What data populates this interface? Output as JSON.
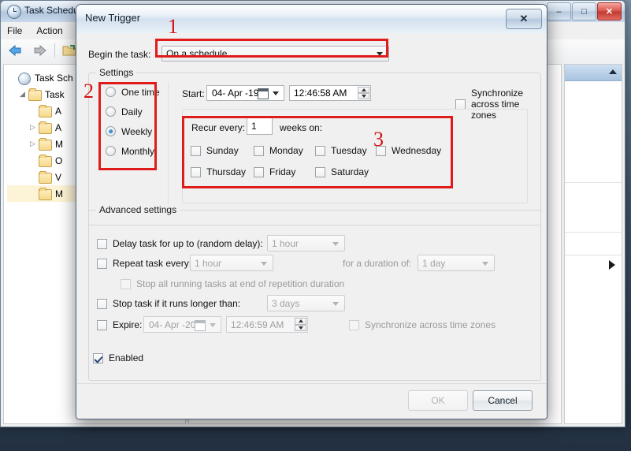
{
  "background_window": {
    "title": "Task Scheduler",
    "icon": "clock-icon",
    "menu": [
      "File",
      "Action"
    ],
    "toolbar_icons": [
      "back-arrow-icon",
      "forward-arrow-icon",
      "new-folder-icon",
      "clock-icon"
    ],
    "tree": [
      {
        "label": "Task Sch",
        "icon": "clock-icon",
        "indent": 0,
        "twisty": ""
      },
      {
        "label": "Task",
        "icon": "task-folder-icon",
        "indent": 1,
        "twisty": "◢"
      },
      {
        "label": "A",
        "icon": "folder-icon",
        "indent": 2,
        "twisty": ""
      },
      {
        "label": "A",
        "icon": "folder-icon",
        "indent": 2,
        "twisty": "▷"
      },
      {
        "label": "M",
        "icon": "folder-icon",
        "indent": 2,
        "twisty": "▷"
      },
      {
        "label": "O",
        "icon": "folder-icon",
        "indent": 2,
        "twisty": ""
      },
      {
        "label": "V",
        "icon": "folder-icon",
        "indent": 2,
        "twisty": ""
      },
      {
        "label": "M",
        "icon": "folder-icon",
        "indent": 2,
        "twisty": ""
      }
    ],
    "window_buttons": {
      "minimize": "–",
      "maximize": "□",
      "close": "✕"
    }
  },
  "dialog": {
    "title": "New Trigger",
    "close_label": "✕",
    "begin_task": {
      "label": "Begin the task:",
      "value": "On a schedule"
    },
    "settings": {
      "group_title": "Settings",
      "schedule_options": [
        {
          "label": "One time",
          "selected": false
        },
        {
          "label": "Daily",
          "selected": false
        },
        {
          "label": "Weekly",
          "selected": true
        },
        {
          "label": "Monthly",
          "selected": false
        }
      ],
      "start_label": "Start:",
      "start_date": "04- Apr -19",
      "start_time": "12:46:58 AM",
      "sync_timezones_label": "Synchronize across time zones",
      "sync_timezones_checked": false,
      "recur_label": "Recur every:",
      "recur_value": "1",
      "weeks_on_label": "weeks on:",
      "days": [
        {
          "label": "Sunday",
          "checked": false
        },
        {
          "label": "Monday",
          "checked": false
        },
        {
          "label": "Tuesday",
          "checked": false
        },
        {
          "label": "Wednesday",
          "checked": false
        },
        {
          "label": "Thursday",
          "checked": false
        },
        {
          "label": "Friday",
          "checked": false
        },
        {
          "label": "Saturday",
          "checked": false
        }
      ]
    },
    "advanced": {
      "group_title": "Advanced settings",
      "delay_label": "Delay task for up to (random delay):",
      "delay_value": "1 hour",
      "delay_checked": false,
      "repeat_label": "Repeat task every:",
      "repeat_value": "1 hour",
      "repeat_checked": false,
      "duration_label": "for a duration of:",
      "duration_value": "1 day",
      "stop_repetition_label": "Stop all running tasks at end of repetition duration",
      "stop_repetition_checked": false,
      "stop_longer_label": "Stop task if it runs longer than:",
      "stop_longer_value": "3 days",
      "stop_longer_checked": false,
      "expire_label": "Expire:",
      "expire_date": "04- Apr -20",
      "expire_time": "12:46:59 AM",
      "expire_checked": false,
      "expire_sync_label": "Synchronize across time zones",
      "expire_sync_checked": false,
      "enabled_label": "Enabled",
      "enabled_checked": true
    },
    "footer": {
      "ok_label": "OK",
      "cancel_label": "Cancel"
    }
  },
  "annotations": {
    "accent_color": "#e01b1b",
    "marks": [
      {
        "id": "1",
        "target": "begin-task-dropdown"
      },
      {
        "id": "2",
        "target": "schedule-radio-group"
      },
      {
        "id": "3",
        "target": "weekly-recurrence-panel"
      }
    ]
  }
}
